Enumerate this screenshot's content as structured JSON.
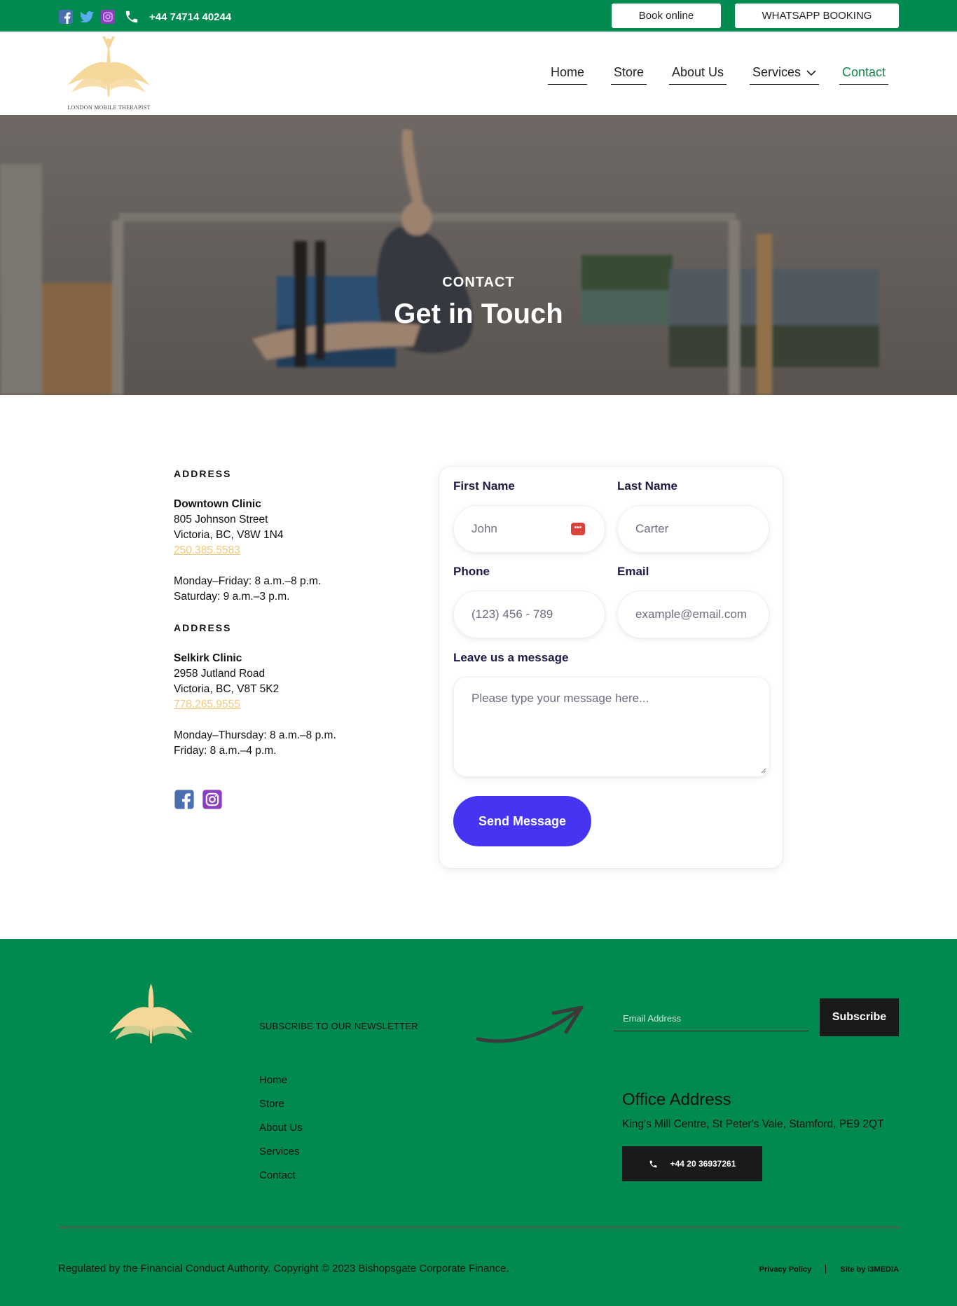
{
  "topbar": {
    "phone": "+44 74714 40244",
    "book_label": "Book online",
    "whatsapp_label": "WHATSAPP BOOKING"
  },
  "header": {
    "logo_caption": "LONDON MOBILE THERAPIST",
    "nav": [
      {
        "label": "Home"
      },
      {
        "label": "Store"
      },
      {
        "label": "About Us"
      },
      {
        "label": "Services"
      },
      {
        "label": "Contact"
      }
    ],
    "active": "Contact"
  },
  "hero": {
    "eyebrow": "CONTACT",
    "title": "Get in Touch"
  },
  "locations": [
    {
      "label": "ADDRESS",
      "name": "Downtown Clinic",
      "street": "805 Johnson Street",
      "city": "Victoria, BC, V8W 1N4",
      "phone": "250.385.5583",
      "hours1": "Monday–Friday: 8 a.m.–8 p.m.",
      "hours2": "Saturday: 9 a.m.–3 p.m."
    },
    {
      "label": "ADDRESS",
      "name": "Selkirk Clinic",
      "street": "2958 Jutland Road",
      "city": "Victoria, BC, V8T 5K2",
      "phone": "778.265.9555",
      "hours1": "Monday–Thursday: 8 a.m.–8 p.m.",
      "hours2": "Friday: 8 a.m.–4 p.m."
    }
  ],
  "form": {
    "first_name_label": "First Name",
    "first_name_placeholder": "John",
    "last_name_label": "Last Name",
    "last_name_placeholder": "Carter",
    "phone_label": "Phone",
    "phone_placeholder": "(123) 456 - 789",
    "email_label": "Email",
    "email_placeholder": "example@email.com",
    "message_label": "Leave us a message",
    "message_placeholder": "Please type your message here...",
    "send_label": "Send Message"
  },
  "footer": {
    "newsletter_title": "SUBSCRIBE TO OUR NEWSLETTER",
    "email_placeholder": "Email Address",
    "subscribe_label": "Subscribe",
    "links": [
      "Home",
      "Store",
      "About Us",
      "Services",
      "Contact"
    ],
    "office_title": "Office Address",
    "office_address": "King's Mill Centre, St Peter's Vale, Stamford, PE9 2QT",
    "office_phone": "+44 20 36937261",
    "copyright": "Regulated by the Financial Conduct Authority. Copyright © 2023 Bishopsgate Corporate Finance.",
    "privacy_label": "Privacy Policy",
    "credit_label": "Site by i3MEDIA"
  },
  "colors": {
    "brand_green": "#008a50",
    "accent_gold": "#f2c879",
    "send_button": "#4535f3",
    "dark": "#1a1a1a"
  },
  "icons": [
    "facebook-icon",
    "twitter-icon",
    "instagram-icon",
    "phone-icon",
    "chevron-down-icon",
    "password-manager-icon",
    "arrow-icon"
  ]
}
